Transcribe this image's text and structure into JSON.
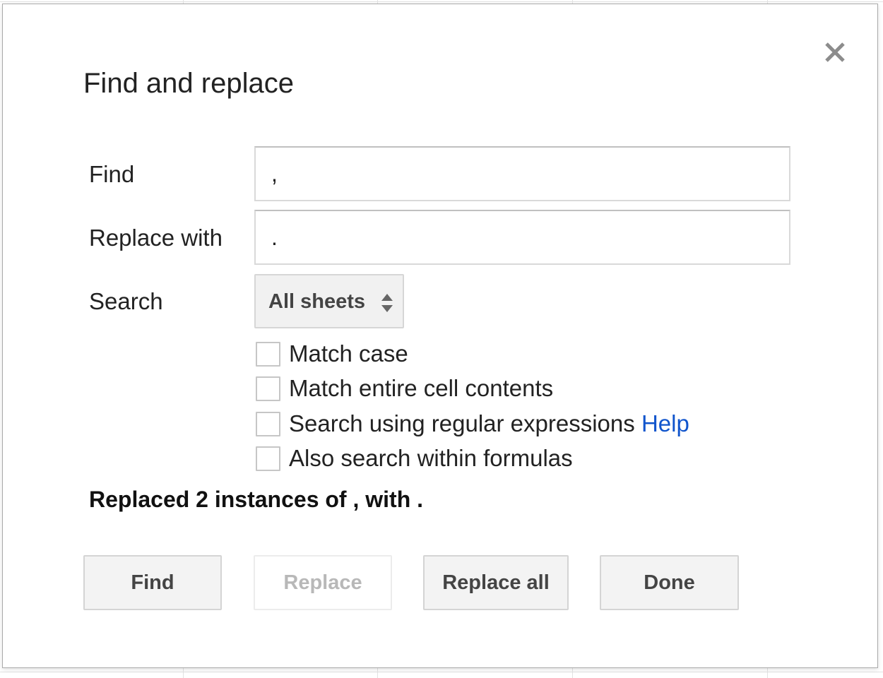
{
  "dialog": {
    "title": "Find and replace",
    "close_icon": "close-icon"
  },
  "fields": {
    "find_label": "Find",
    "find_value": ",",
    "replace_label": "Replace with",
    "replace_value": ".",
    "search_label": "Search",
    "search_selected": "All sheets"
  },
  "options": {
    "match_case": {
      "label": "Match case",
      "checked": false
    },
    "match_entire": {
      "label": "Match entire cell contents",
      "checked": false
    },
    "regex": {
      "label": "Search using regular expressions",
      "help_label": "Help",
      "checked": false
    },
    "formulas": {
      "label": "Also search within formulas",
      "checked": false
    }
  },
  "status": "Replaced 2 instances of , with .",
  "buttons": {
    "find": "Find",
    "replace": "Replace",
    "replace_all": "Replace all",
    "done": "Done"
  },
  "colors": {
    "link": "#1155cc",
    "button_bg": "#f3f3f3",
    "disabled_text": "#b8b8b8"
  }
}
